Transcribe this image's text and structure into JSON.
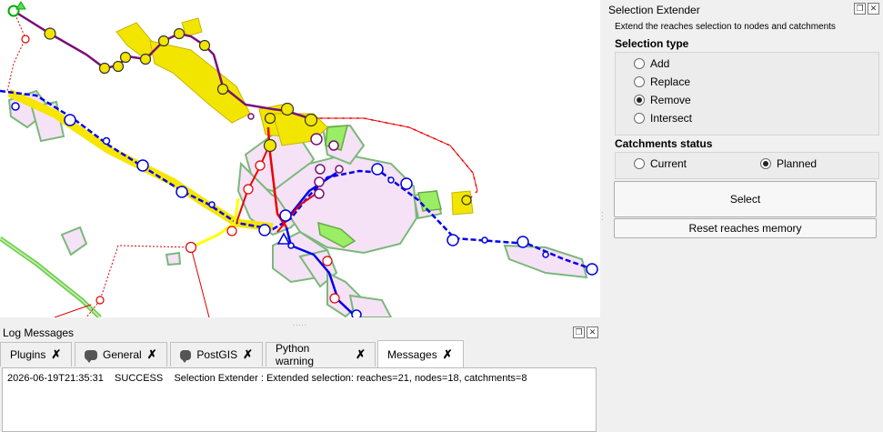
{
  "dock": {
    "title": "Selection Extender",
    "description": "Extend the reaches selection to nodes and catchments",
    "float_icon": "float-icon",
    "close_icon": "close-icon",
    "selection_type": {
      "title": "Selection type",
      "options": [
        "Add",
        "Replace",
        "Remove",
        "Intersect"
      ],
      "selected": "Remove"
    },
    "catchments_status": {
      "title": "Catchments status",
      "options": [
        "Current",
        "Planned"
      ],
      "selected": "Planned"
    },
    "select_label": "Select",
    "reset_label": "Reset reaches memory"
  },
  "log": {
    "title": "Log Messages",
    "tabs": [
      {
        "label": "Plugins",
        "icon": "",
        "active": false
      },
      {
        "label": "General",
        "icon": "chat-bubble-icon",
        "active": false
      },
      {
        "label": "PostGIS",
        "icon": "chat-bubble-icon",
        "active": false
      },
      {
        "label": "Python warning",
        "icon": "",
        "active": false
      },
      {
        "label": "Messages",
        "icon": "",
        "active": true
      }
    ],
    "close_glyph": "✗",
    "line": {
      "timestamp": "2026-06-19T21:35:31",
      "level": "SUCCESS",
      "message": "Selection Extender : Extended selection: reaches=21, nodes=18, catchments=8"
    }
  },
  "colors": {
    "catchment_fill": "#f5e1f5",
    "catchment_stroke": "#6aaa6a",
    "reach_yellow": "#ffff00",
    "node_yellow": "#f2e600",
    "reach_blue": "#0000ff",
    "reach_red": "#ff0000",
    "reach_purple": "#7a0f7a",
    "green_polygon": "#99ee66"
  }
}
